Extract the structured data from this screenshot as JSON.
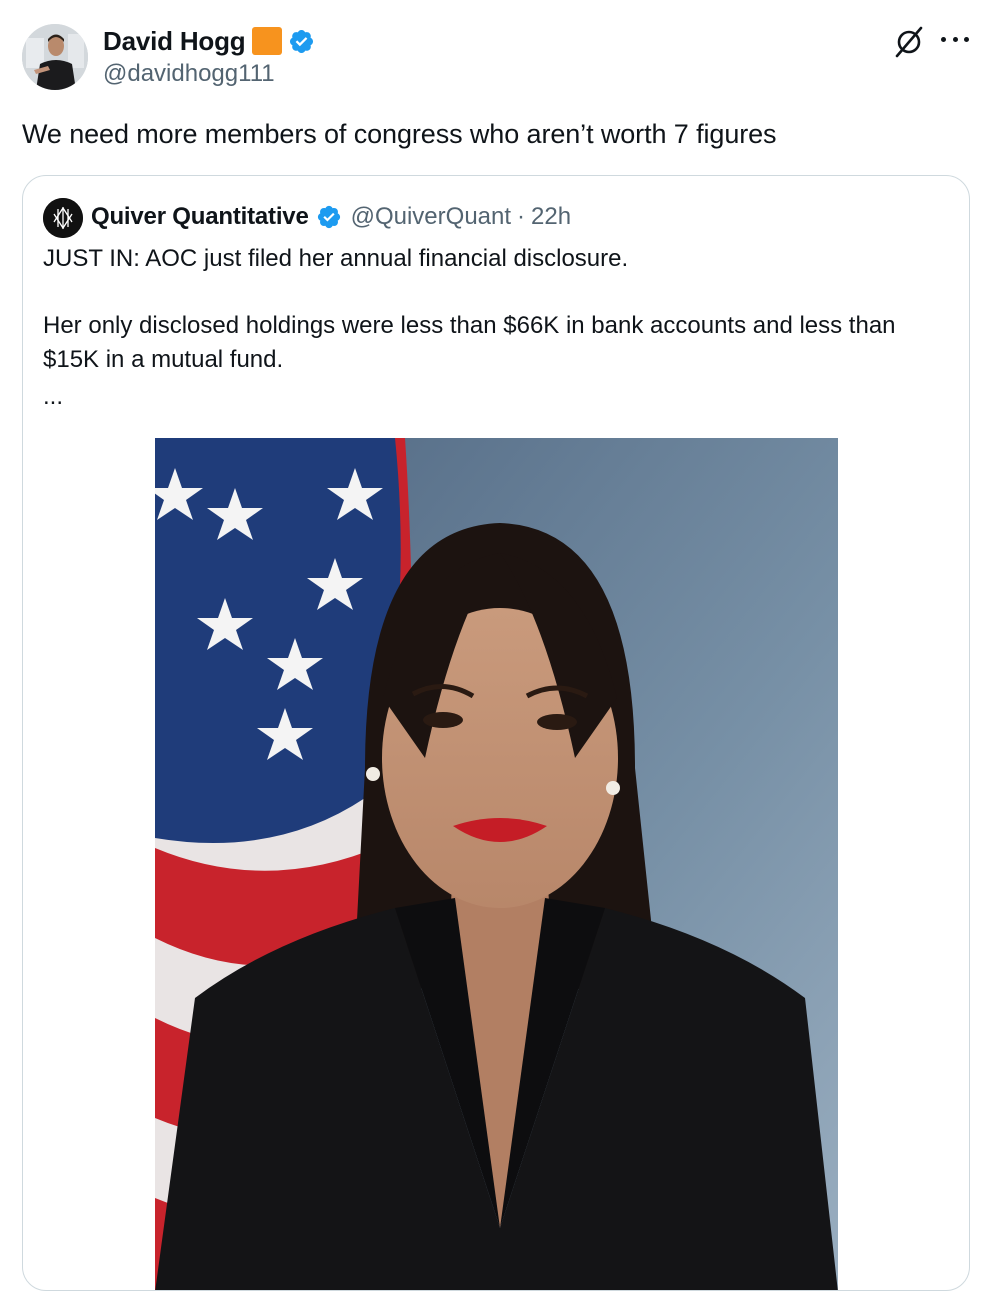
{
  "author": {
    "display_name": "David Hogg",
    "handle": "@davidhogg111",
    "flag_emoji_color": "#f7931e",
    "verified_color": "#1d9bf0",
    "avatar": "avatar"
  },
  "header_actions": {
    "grok_icon": "grok-icon",
    "more_icon": "more-icon"
  },
  "tweet": {
    "text": "We need more members of congress who aren’t worth 7 figures"
  },
  "quoted_tweet": {
    "display_name": "Quiver Quantitative",
    "handle": "@QuiverQuant",
    "separator": "·",
    "time": "22h",
    "paragraph_1": "JUST IN: AOC just filed her annual financial disclosure.",
    "paragraph_2": "Her only disclosed holdings were less than $66K in bank accounts and less than $15K in a mutual fund.",
    "truncation": "...",
    "media": "portrait photo in front of American flag"
  },
  "colors": {
    "text_primary": "#0f1419",
    "text_secondary": "#536471",
    "border": "#cfd9de",
    "accent": "#1d9bf0"
  }
}
